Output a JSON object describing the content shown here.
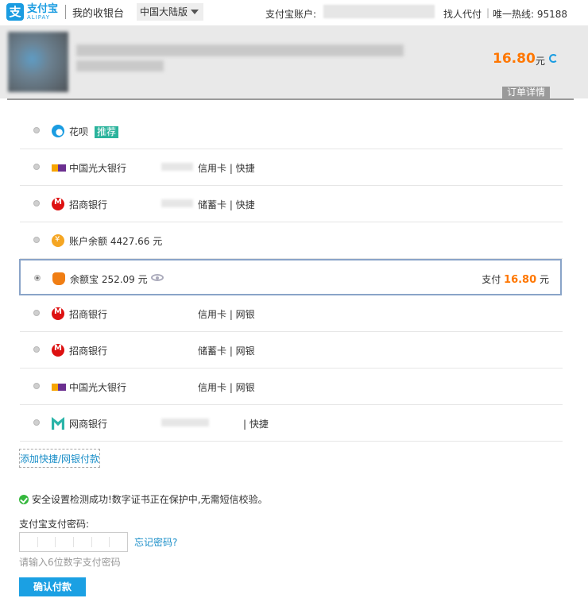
{
  "header": {
    "logo_cn": "支付宝",
    "logo_en": "ALIPAY",
    "cashier": "我的收银台",
    "region": "中国大陆版",
    "account_label": "支付宝账户:",
    "find_pay": "找人代付",
    "separator": "|",
    "hotline": "唯一热线: 95188"
  },
  "order": {
    "amount": "16.80",
    "unit": "元",
    "detail_label": "订单详情"
  },
  "methods": [
    {
      "name": "花呗",
      "badge": "推荐",
      "type": "",
      "icon": "huabei-icon"
    },
    {
      "name": "中国光大银行",
      "type": "信用卡 | 快捷",
      "icon": "bank-icon"
    },
    {
      "name": "招商银行",
      "type": "储蓄卡 | 快捷",
      "icon": "cmb-icon"
    },
    {
      "name": "账户余额 4427.66 元",
      "type": "",
      "icon": "coin-icon"
    },
    {
      "name": "余额宝 252.09 元",
      "type": "",
      "icon": "yuebao-icon",
      "selected": true,
      "pay_prefix": "支付",
      "pay_amount": "16.80",
      "pay_unit": "元"
    },
    {
      "name": "招商银行",
      "type": "信用卡 | 网银",
      "icon": "cmb-icon"
    },
    {
      "name": "招商银行",
      "type": "储蓄卡 | 网银",
      "icon": "cmb-icon"
    },
    {
      "name": "中国光大银行",
      "type": "信用卡 | 网银",
      "icon": "bank-icon"
    },
    {
      "name": "网商银行",
      "type": "| 快捷",
      "icon": "mybank-icon"
    }
  ],
  "add_link": "添加快捷/网银付款",
  "security_note": "安全设置检测成功!数字证书正在保护中,无需短信校验。",
  "password": {
    "label": "支付宝支付密码:",
    "forgot": "忘记密码?",
    "hint": "请输入6位数字支付密码"
  },
  "confirm_label": "确认付款",
  "colors": {
    "brand": "#1a9ce1",
    "amount": "#ff7700",
    "badge": "#2bb39c",
    "confirm": "#1ba0e3"
  }
}
